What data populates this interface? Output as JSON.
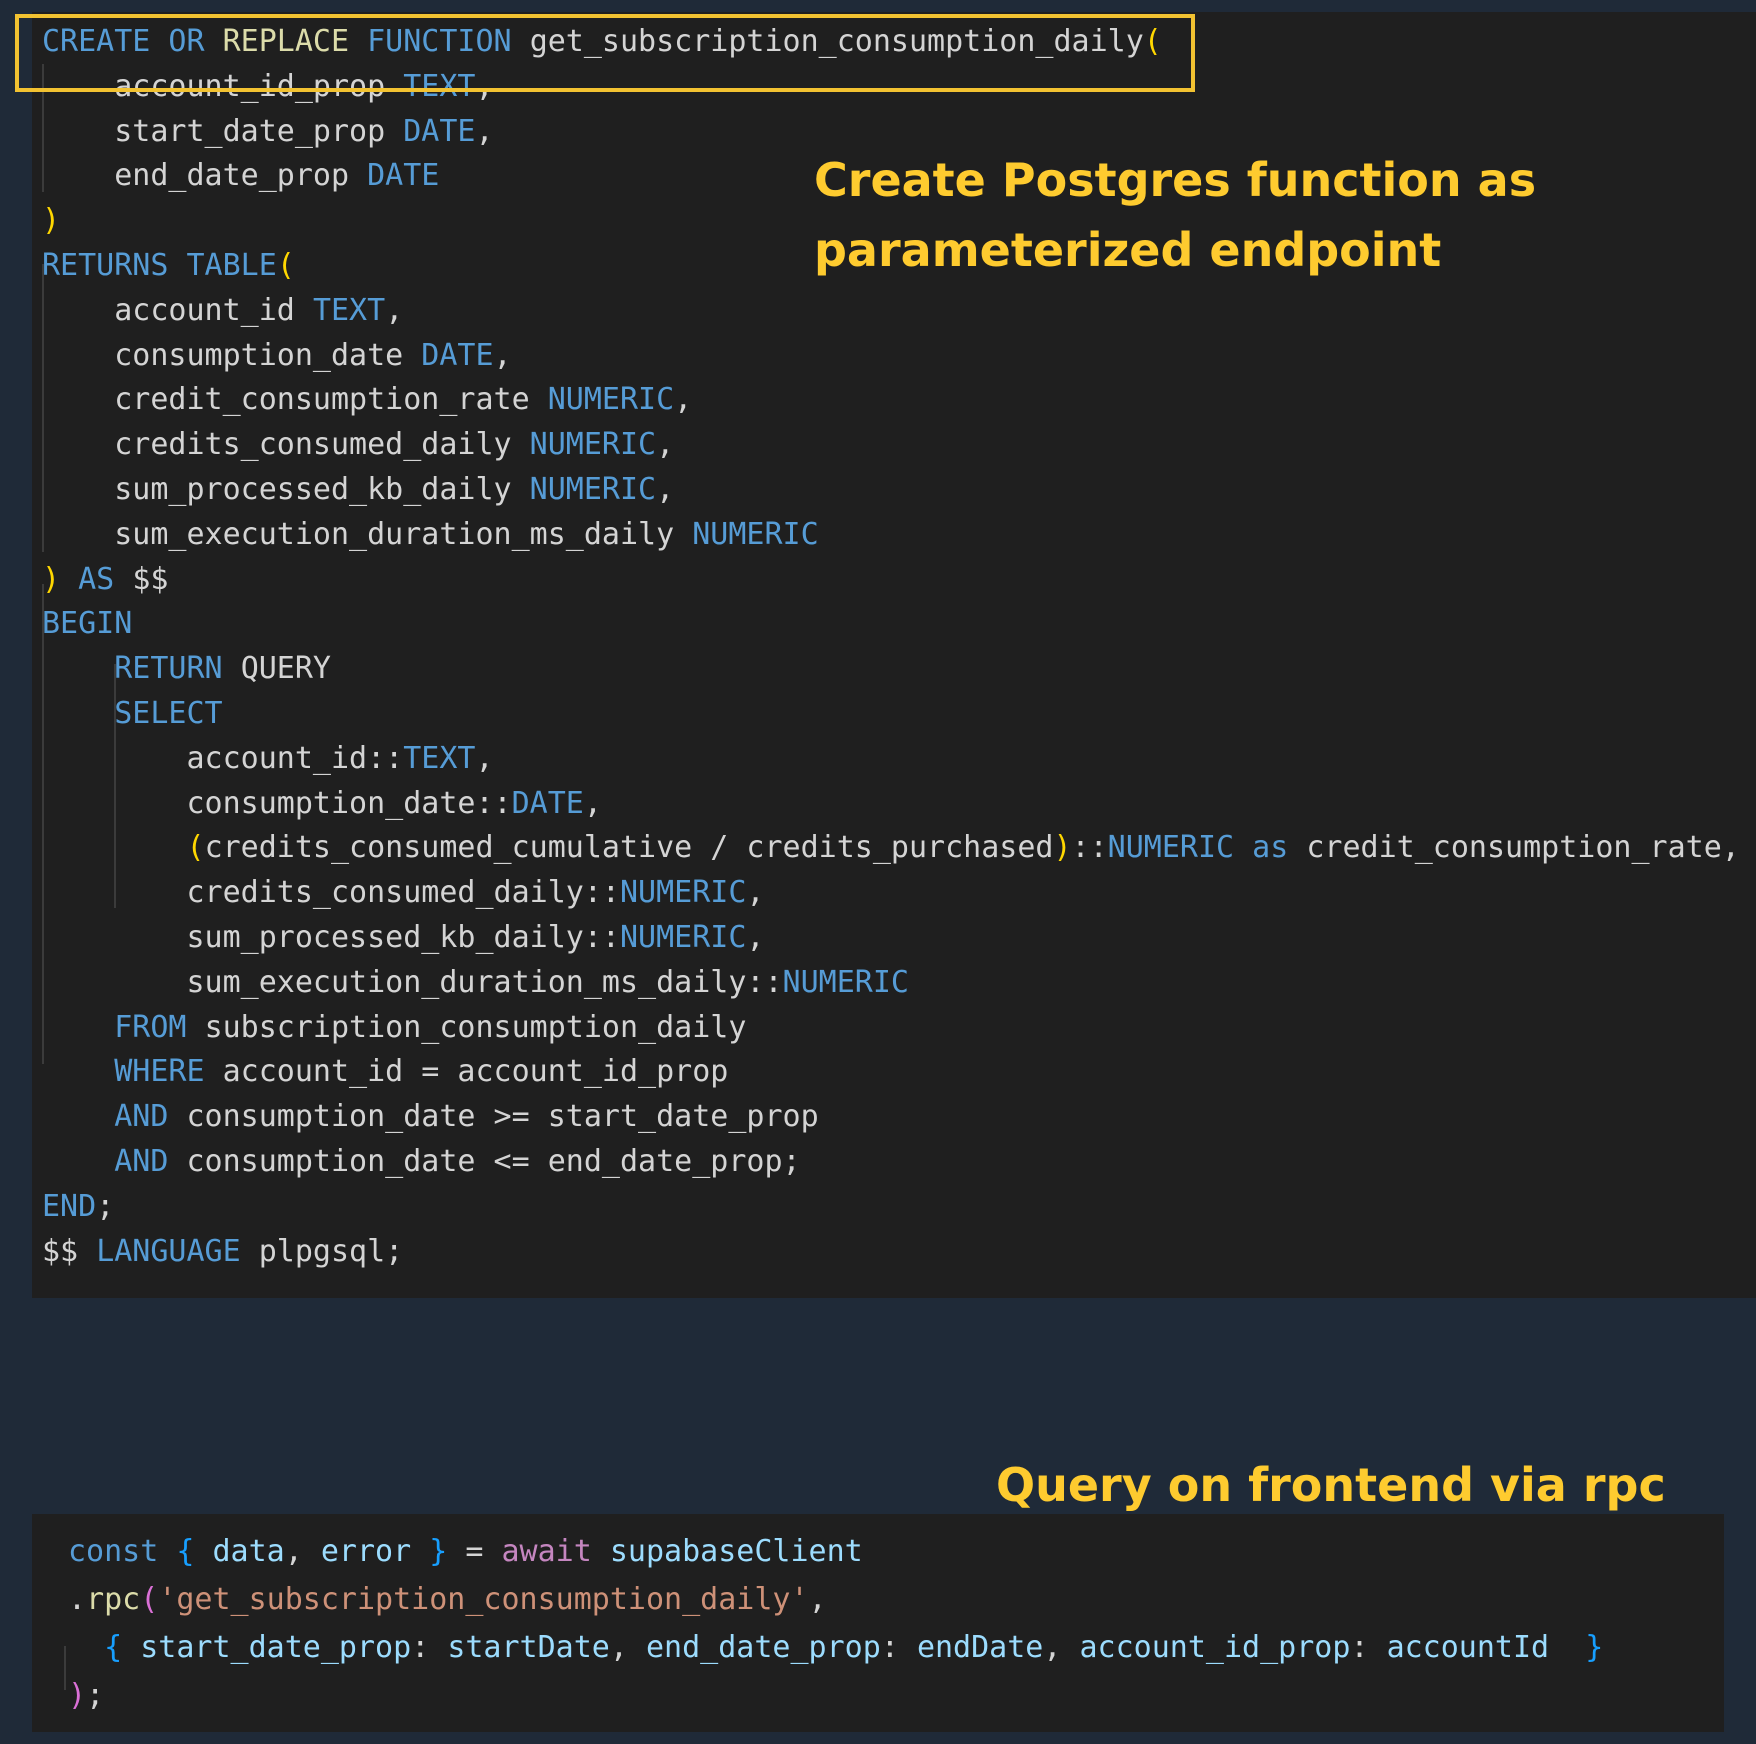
{
  "sql_code": [
    [
      [
        "kw",
        "CREATE OR "
      ],
      [
        "fn",
        "REPLACE"
      ],
      [
        "kw",
        " FUNCTION "
      ],
      [
        "id",
        "get_subscription_consumption_daily"
      ],
      [
        "br",
        "("
      ]
    ],
    [
      [
        "id",
        "    account_id_prop "
      ],
      [
        "kw",
        "TEXT"
      ],
      [
        "pn",
        ","
      ]
    ],
    [
      [
        "id",
        "    start_date_prop "
      ],
      [
        "kw",
        "DATE"
      ],
      [
        "pn",
        ","
      ]
    ],
    [
      [
        "id",
        "    end_date_prop "
      ],
      [
        "kw",
        "DATE"
      ]
    ],
    [
      [
        "br",
        ")"
      ]
    ],
    [
      [
        "kw",
        "RETURNS TABLE"
      ],
      [
        "br",
        "("
      ]
    ],
    [
      [
        "id",
        "    account_id "
      ],
      [
        "kw",
        "TEXT"
      ],
      [
        "pn",
        ","
      ]
    ],
    [
      [
        "id",
        "    consumption_date "
      ],
      [
        "kw",
        "DATE"
      ],
      [
        "pn",
        ","
      ]
    ],
    [
      [
        "id",
        "    credit_consumption_rate "
      ],
      [
        "kw",
        "NUMERIC"
      ],
      [
        "pn",
        ","
      ]
    ],
    [
      [
        "id",
        "    credits_consumed_daily "
      ],
      [
        "kw",
        "NUMERIC"
      ],
      [
        "pn",
        ","
      ]
    ],
    [
      [
        "id",
        "    sum_processed_kb_daily "
      ],
      [
        "kw",
        "NUMERIC"
      ],
      [
        "pn",
        ","
      ]
    ],
    [
      [
        "id",
        "    sum_execution_duration_ms_daily "
      ],
      [
        "kw",
        "NUMERIC"
      ]
    ],
    [
      [
        "br",
        ")"
      ],
      [
        "kw",
        " AS "
      ],
      [
        "id",
        "$$"
      ]
    ],
    [
      [
        "kw",
        "BEGIN"
      ]
    ],
    [
      [
        "kw",
        "    RETURN "
      ],
      [
        "id",
        "QUERY"
      ]
    ],
    [
      [
        "kw",
        "    SELECT"
      ]
    ],
    [
      [
        "id",
        "        account_id::"
      ],
      [
        "kw",
        "TEXT"
      ],
      [
        "pn",
        ","
      ]
    ],
    [
      [
        "id",
        "        consumption_date::"
      ],
      [
        "kw",
        "DATE"
      ],
      [
        "pn",
        ","
      ]
    ],
    [
      [
        "id",
        "        "
      ],
      [
        "br",
        "("
      ],
      [
        "id",
        "credits_consumed_cumulative / credits_purchased"
      ],
      [
        "br",
        ")"
      ],
      [
        "id",
        "::"
      ],
      [
        "kw",
        "NUMERIC as "
      ],
      [
        "id",
        "credit_consumption_rate,"
      ]
    ],
    [
      [
        "id",
        "        credits_consumed_daily::"
      ],
      [
        "kw",
        "NUMERIC"
      ],
      [
        "pn",
        ","
      ]
    ],
    [
      [
        "id",
        "        sum_processed_kb_daily::"
      ],
      [
        "kw",
        "NUMERIC"
      ],
      [
        "pn",
        ","
      ]
    ],
    [
      [
        "id",
        "        sum_execution_duration_ms_daily::"
      ],
      [
        "kw",
        "NUMERIC"
      ]
    ],
    [
      [
        "kw",
        "    FROM "
      ],
      [
        "id",
        "subscription_consumption_daily"
      ]
    ],
    [
      [
        "kw",
        "    WHERE "
      ],
      [
        "id",
        "account_id = account_id_prop"
      ]
    ],
    [
      [
        "kw",
        "    AND "
      ],
      [
        "id",
        "consumption_date >= start_date_prop"
      ]
    ],
    [
      [
        "kw",
        "    AND "
      ],
      [
        "id",
        "consumption_date <= end_date_prop;"
      ]
    ],
    [
      [
        "kw",
        "END"
      ],
      [
        "pn",
        ";"
      ]
    ],
    [
      [
        "id",
        "$$ "
      ],
      [
        "kw",
        "LANGUAGE "
      ],
      [
        "id",
        "plpgsql;"
      ]
    ]
  ],
  "js_code": [
    [
      [
        "jkw",
        "const "
      ],
      [
        "brc",
        "{ "
      ],
      [
        "var",
        "data"
      ],
      [
        "pn",
        ", "
      ],
      [
        "var",
        "error "
      ],
      [
        "brc",
        "}"
      ],
      [
        "pn",
        " = "
      ],
      [
        "ctl",
        "await "
      ],
      [
        "var",
        "supabaseClient"
      ]
    ],
    [
      [
        "pn",
        "."
      ],
      [
        "fn",
        "rpc"
      ],
      [
        "ctl-br",
        "("
      ],
      [
        "str",
        "'get_subscription_consumption_daily'"
      ],
      [
        "pn",
        ","
      ]
    ],
    [
      [
        "pn",
        "  "
      ],
      [
        "brc",
        "{ "
      ],
      [
        "var",
        "start_date_prop"
      ],
      [
        "pn",
        ": "
      ],
      [
        "var",
        "startDate"
      ],
      [
        "pn",
        ", "
      ],
      [
        "var",
        "end_date_prop"
      ],
      [
        "pn",
        ": "
      ],
      [
        "var",
        "endDate"
      ],
      [
        "pn",
        ", "
      ],
      [
        "var",
        "account_id_prop"
      ],
      [
        "pn",
        ": "
      ],
      [
        "var",
        "accountId  "
      ],
      [
        "brc",
        "}"
      ]
    ],
    [
      [
        "ctl-br",
        ")"
      ],
      [
        "pn",
        ";"
      ]
    ]
  ],
  "annotations": {
    "function_note_line1": "Create Postgres function as",
    "function_note_line2": "parameterized endpoint",
    "frontend_note": "Query on frontend via rpc"
  },
  "colors": {
    "annotation": "#fecb2f",
    "highlight_border": "#f2c231",
    "page_background": "#1f2a38",
    "editor_background": "#1f1f1f"
  }
}
